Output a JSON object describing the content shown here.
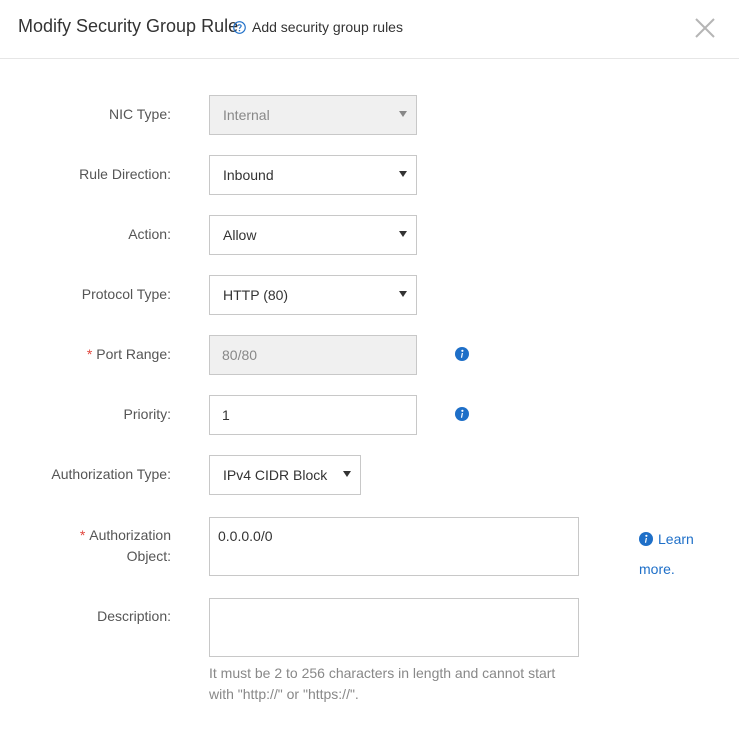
{
  "header": {
    "title": "Modify Security Group Rule",
    "help_link": "Add security group rules"
  },
  "form": {
    "nic_type": {
      "label": "NIC Type:",
      "value": "Internal",
      "disabled": true
    },
    "rule_direction": {
      "label": "Rule Direction:",
      "value": "Inbound"
    },
    "action": {
      "label": "Action:",
      "value": "Allow"
    },
    "protocol_type": {
      "label": "Protocol Type:",
      "value": "HTTP (80)"
    },
    "port_range": {
      "required_mark": "*",
      "label": "Port Range:",
      "value": "80/80",
      "disabled": true
    },
    "priority": {
      "label": "Priority:",
      "value": "1"
    },
    "authorization_type": {
      "label": "Authorization Type:",
      "value": "IPv4 CIDR Block"
    },
    "authorization_object": {
      "required_mark": "*",
      "label_line1": "Authorization",
      "label_line2": "Object:",
      "value": "0.0.0.0/0",
      "learn_more": "Learn more."
    },
    "description": {
      "label": "Description:",
      "value": "",
      "hint_line1": "It must be 2 to 256 characters in length and cannot start",
      "hint_line2": "with \"http://\" or \"https://\"."
    }
  },
  "icons": {
    "help": "question-circle-icon",
    "close": "close-icon",
    "info": "info-circle-icon"
  },
  "colors": {
    "accent": "#1e6fc8",
    "required": "#e0463d",
    "disabled_bg": "#f0f0f0",
    "border": "#c8c8c8"
  }
}
